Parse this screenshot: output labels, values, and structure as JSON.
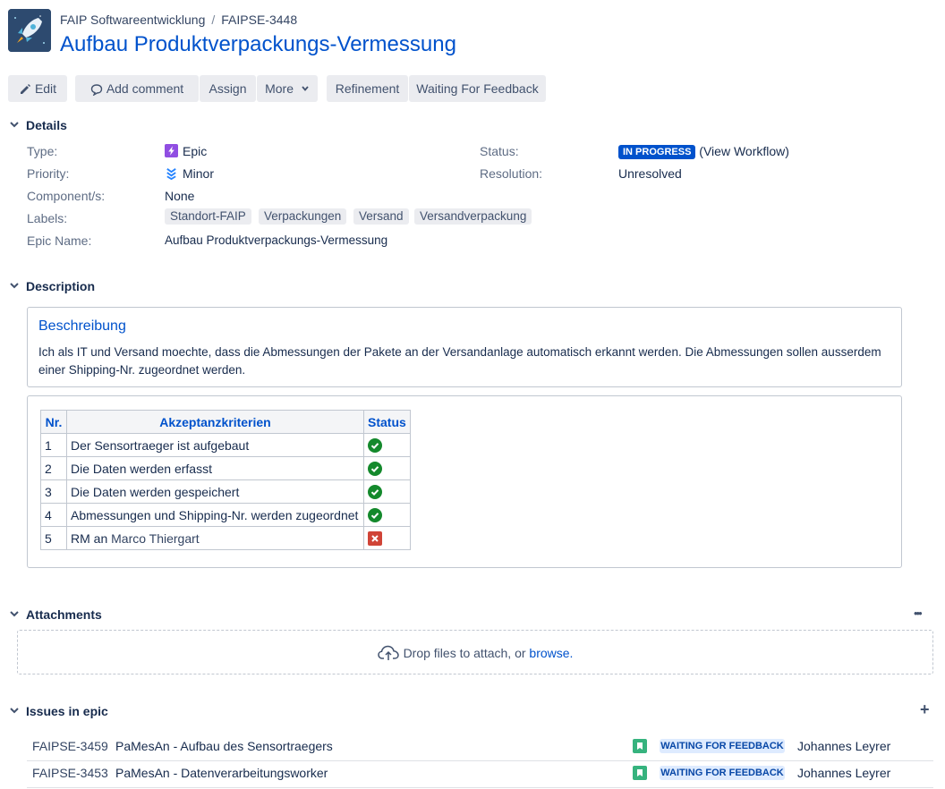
{
  "header": {
    "project": "FAIP Softwareentwicklung",
    "separator": "/",
    "issue_key": "FAIPSE-3448",
    "title": "Aufbau Produktverpackungs-Vermessung"
  },
  "toolbar": {
    "edit": "Edit",
    "add_comment": "Add comment",
    "assign": "Assign",
    "more": "More",
    "refinement": "Refinement",
    "waiting_for_feedback": "Waiting For Feedback"
  },
  "details": {
    "heading": "Details",
    "type_label": "Type:",
    "type_value": "Epic",
    "priority_label": "Priority:",
    "priority_value": "Minor",
    "component_label": "Component/s:",
    "component_value": "None",
    "labels_label": "Labels:",
    "labels": [
      "Standort-FAIP",
      "Verpackungen",
      "Versand",
      "Versandverpackung"
    ],
    "epic_name_label": "Epic Name:",
    "epic_name_value": "Aufbau Produktverpackungs-Vermessung",
    "status_label": "Status:",
    "status_value": "IN PROGRESS",
    "view_workflow": "(View Workflow)",
    "resolution_label": "Resolution:",
    "resolution_value": "Unresolved"
  },
  "description": {
    "heading": "Description",
    "panel_title": "Beschreibung",
    "panel_text": "Ich als IT und Versand moechte, dass die Abmessungen der Pakete an der Versandanlage automatisch erkannt werden. Die Abmessungen sollen ausserdem einer Shipping-Nr. zugeordnet werden.",
    "table": {
      "headers": [
        "Nr.",
        "Akzeptanzkriterien",
        "Status"
      ],
      "rows": [
        {
          "nr": "1",
          "text": "Der Sensortraeger ist aufgebaut",
          "status": "done"
        },
        {
          "nr": "2",
          "text": "Die Daten werden erfasst",
          "status": "done"
        },
        {
          "nr": "3",
          "text": "Die Daten werden gespeichert",
          "status": "done"
        },
        {
          "nr": "4",
          "text": "Abmessungen und Shipping-Nr. werden zugeordnet",
          "status": "done"
        },
        {
          "nr": "5",
          "text_prefix": "RM an ",
          "text_link": "Marco Thiergart",
          "status": "failed"
        }
      ]
    }
  },
  "attachments": {
    "heading": "Attachments",
    "more": "•••",
    "drop_text": "Drop files to attach, or ",
    "browse": "browse."
  },
  "issues_in_epic": {
    "heading": "Issues in epic",
    "add": "+",
    "rows": [
      {
        "key": "FAIPSE-3459",
        "summary": "PaMesAn - Aufbau des Sensortraegers",
        "status": "WAITING FOR FEEDBACK",
        "assignee": "Johannes Leyrer"
      },
      {
        "key": "FAIPSE-3453",
        "summary": "PaMesAn - Datenverarbeitungsworker",
        "status": "WAITING FOR FEEDBACK",
        "assignee": "Johannes Leyrer"
      }
    ]
  },
  "colors": {
    "accent": "#0052cc",
    "in_progress": "#0052cc",
    "done": "#14892c",
    "failed": "#d04437",
    "story": "#36b37e"
  }
}
